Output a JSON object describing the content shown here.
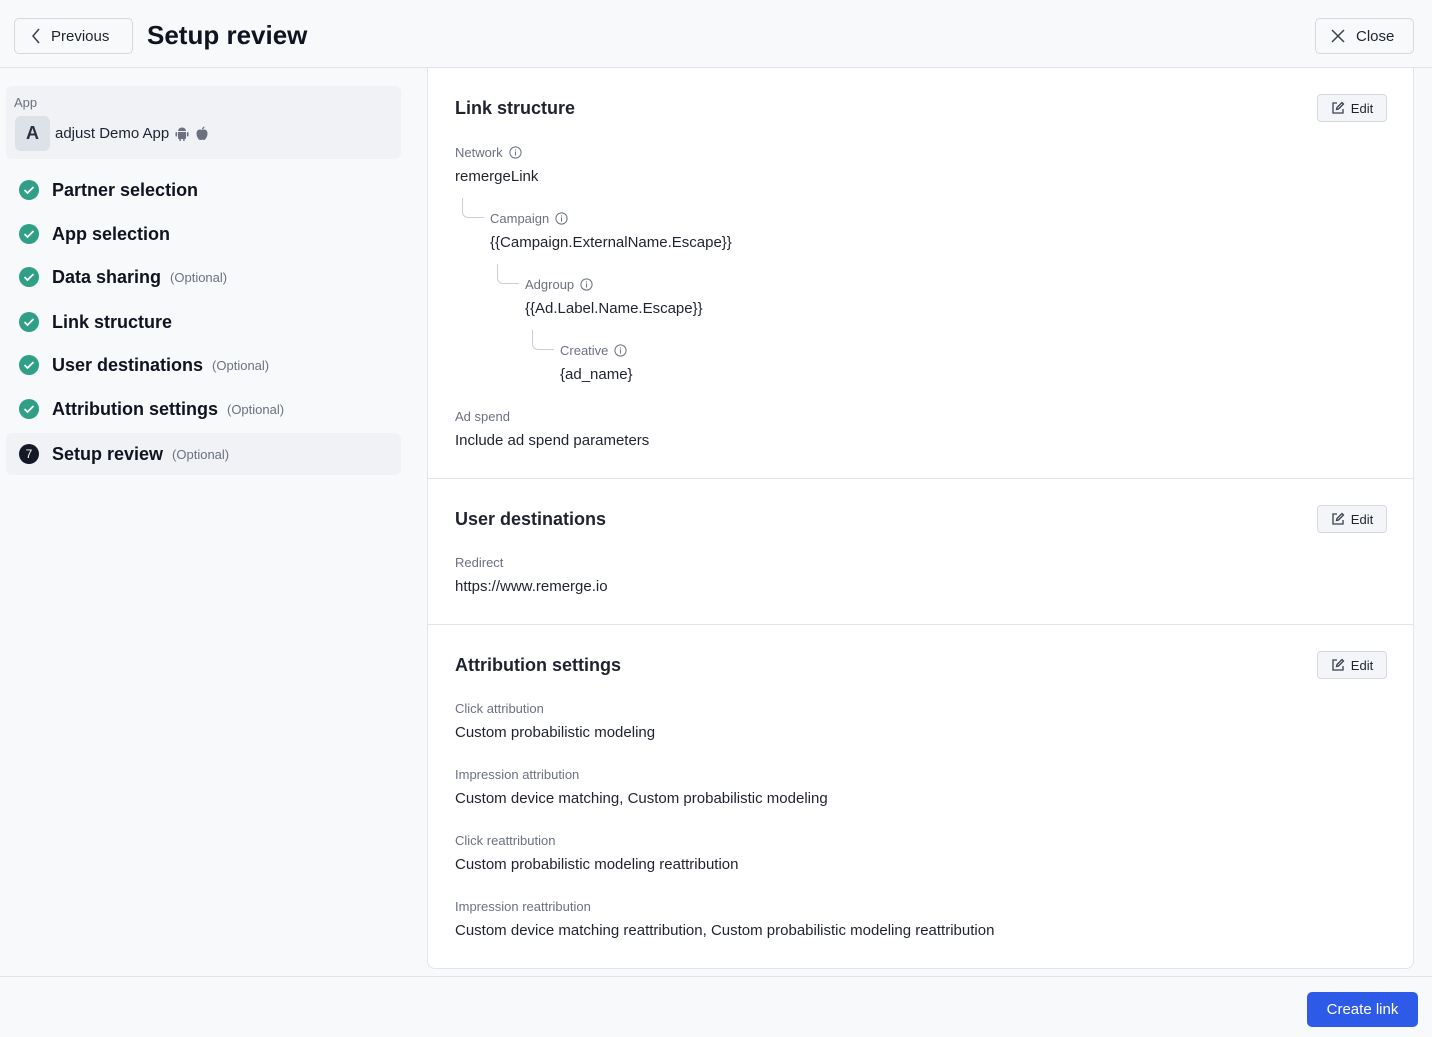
{
  "header": {
    "previous_label": "Previous",
    "title": "Setup review",
    "close_label": "Close"
  },
  "sidebar": {
    "app_label": "App",
    "app_initial": "A",
    "app_name": "adjust Demo App",
    "platform_icons": [
      "android-icon",
      "apple-icon"
    ],
    "steps": [
      {
        "label": "Partner selection",
        "optional": "",
        "status": "complete"
      },
      {
        "label": "App selection",
        "optional": "",
        "status": "complete"
      },
      {
        "label": "Data sharing",
        "optional": "(Optional)",
        "status": "complete"
      },
      {
        "label": "Link structure",
        "optional": "",
        "status": "complete"
      },
      {
        "label": "User destinations",
        "optional": "(Optional)",
        "status": "complete"
      },
      {
        "label": "Attribution settings",
        "optional": "(Optional)",
        "status": "complete"
      },
      {
        "label": "Setup review",
        "optional": "(Optional)",
        "status": "current",
        "number": "7"
      }
    ]
  },
  "sections": {
    "link_structure": {
      "title": "Link structure",
      "edit_label": "Edit",
      "network_label": "Network",
      "network_value": "remergeLink",
      "campaign_label": "Campaign",
      "campaign_value": "{{Campaign.ExternalName.Escape}}",
      "adgroup_label": "Adgroup",
      "adgroup_value": "{{Ad.Label.Name.Escape}}",
      "creative_label": "Creative",
      "creative_value": "{ad_name}",
      "adspend_label": "Ad spend",
      "adspend_value": "Include ad spend parameters"
    },
    "user_destinations": {
      "title": "User destinations",
      "edit_label": "Edit",
      "redirect_label": "Redirect",
      "redirect_value": "https://www.remerge.io"
    },
    "attribution_settings": {
      "title": "Attribution settings",
      "edit_label": "Edit",
      "click_attr_label": "Click attribution",
      "click_attr_value": "Custom probabilistic modeling",
      "imp_attr_label": "Impression attribution",
      "imp_attr_value": "Custom device matching, Custom probabilistic modeling",
      "click_reattr_label": "Click reattribution",
      "click_reattr_value": "Custom probabilistic modeling reattribution",
      "imp_reattr_label": "Impression reattribution",
      "imp_reattr_value": "Custom device matching reattribution, Custom probabilistic modeling reattribution"
    }
  },
  "footer": {
    "create_label": "Create link"
  },
  "colors": {
    "accent": "#2d5ae6",
    "success": "#2f9f86"
  }
}
